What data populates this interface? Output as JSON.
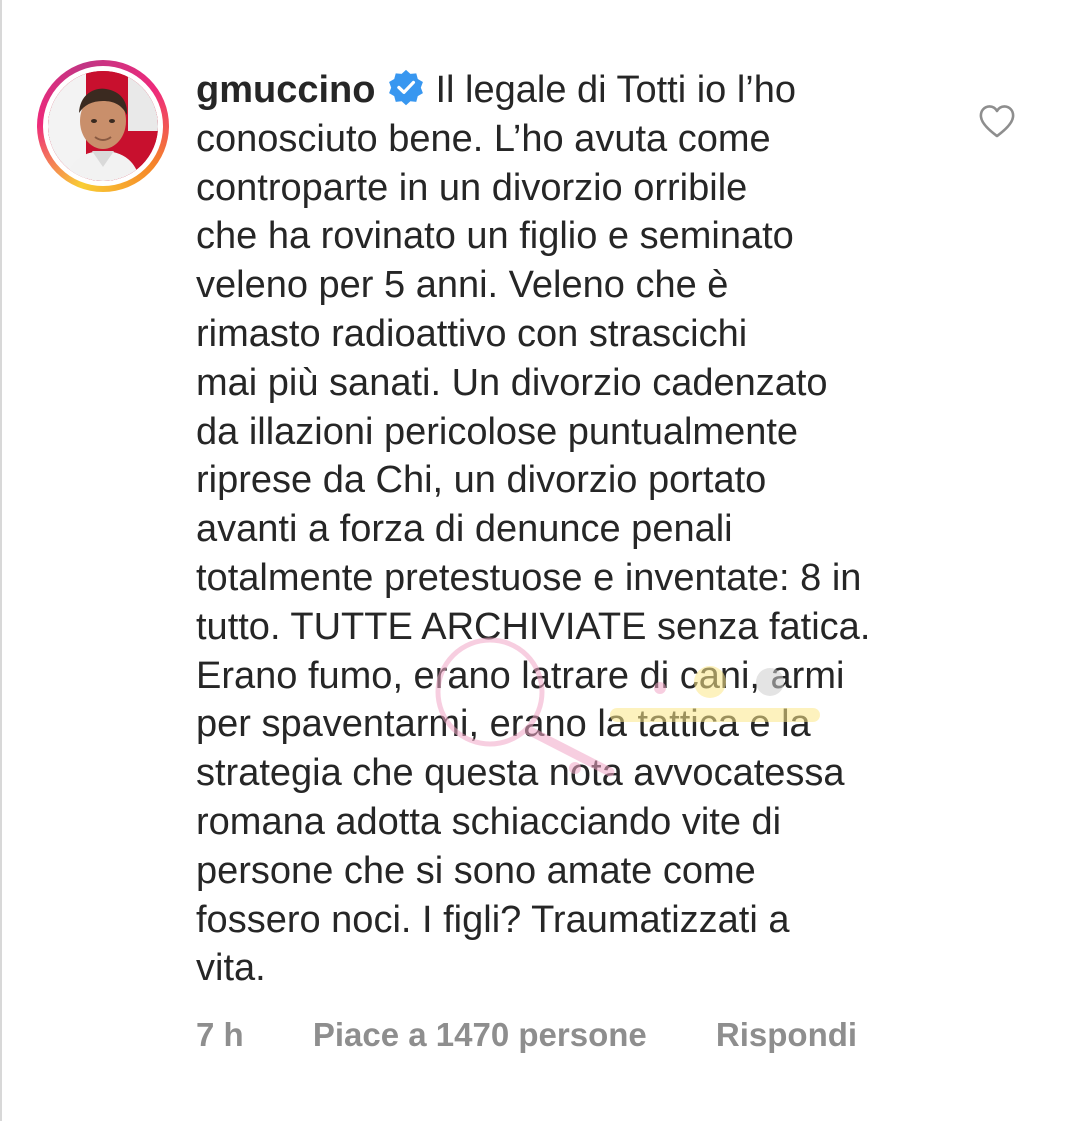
{
  "comment": {
    "username": "gmuccino",
    "verified_icon": "verified-badge-icon",
    "text_lines": [
      "Il legale di Totti io l’ho",
      "conosciuto bene. L’ho avuta come",
      "controparte in un divorzio orribile",
      "che ha rovinato un figlio e seminato",
      "veleno per 5 anni. Veleno che è",
      "rimasto radioattivo con strascichi",
      "mai più sanati. Un divorzio cadenzato",
      "da illazioni pericolose puntualmente",
      "riprese da Chi, un divorzio portato",
      "avanti a forza di denunce penali",
      "totalmente pretestuose e inventate: 8 in",
      "tutto. TUTTE ARCHIVIATE senza fatica.",
      "Erano fumo, erano latrare di cani, armi",
      "per spaventarmi, erano la tattica e la",
      "strategia che questa nota avvocatessa",
      "romana adotta schiacciando vite di",
      "persone che si sono amate come",
      "fossero noci. I figli? Traumatizzati a",
      "vita."
    ],
    "time": "7 h",
    "likes": "Piace a 1470 persone",
    "reply": "Rispondi",
    "like_icon": "heart-outline-icon"
  },
  "colors": {
    "text": "#262626",
    "secondary": "#8e8e8e",
    "verified": "#3897f0",
    "background": "#ffffff"
  }
}
